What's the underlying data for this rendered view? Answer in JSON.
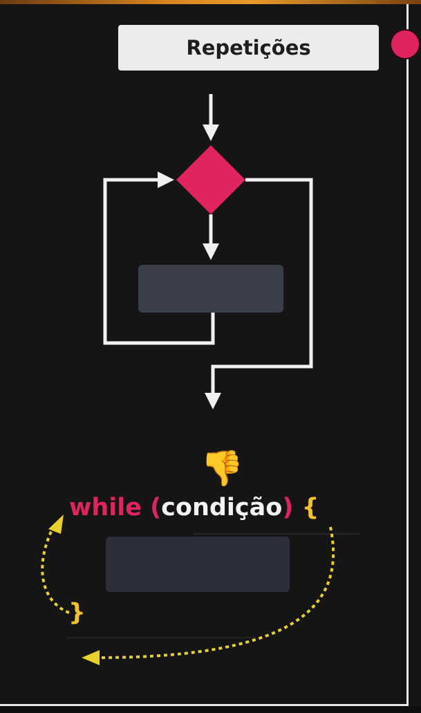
{
  "title": "Repetições",
  "code": {
    "keyword": "while",
    "open_paren": "(",
    "condition": "condição",
    "close_paren": ")",
    "open_brace": "{",
    "close_brace": "}"
  },
  "icons": {
    "thumbs_down": "👎"
  },
  "colors": {
    "accent": "#e0245e",
    "brace": "#f2c12e",
    "block": "#3a3d4a",
    "line": "#f0f0f0",
    "dotted_arrow": "#e8d12a"
  }
}
